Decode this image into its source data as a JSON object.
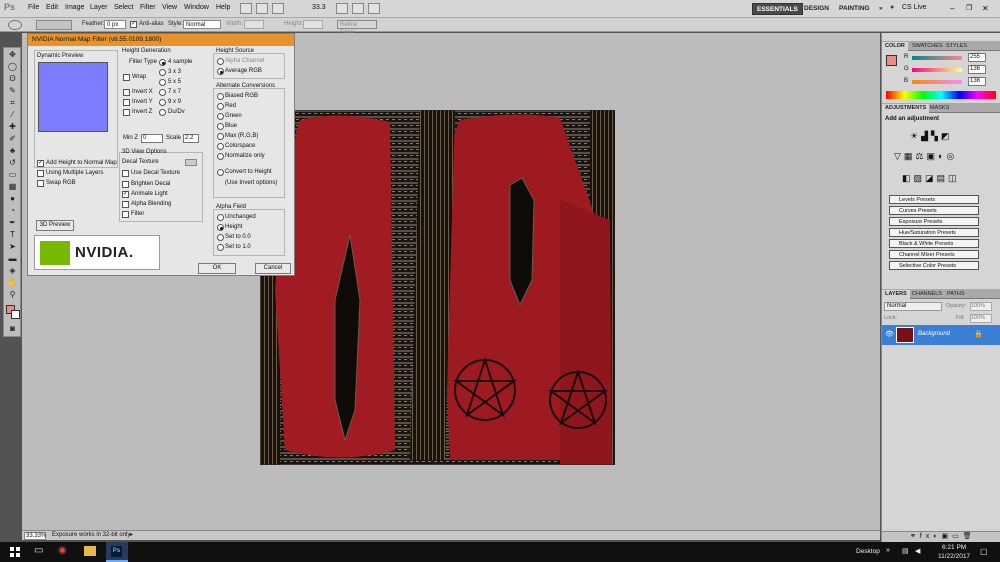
{
  "menu": {
    "logo": "Ps",
    "items": [
      "File",
      "Edit",
      "Image",
      "Layer",
      "Select",
      "Filter",
      "View",
      "Window",
      "Help"
    ],
    "zoom": "33.3",
    "workspaces": [
      "ESSENTIALS",
      "DESIGN",
      "PAINTING"
    ],
    "cs_live": "CS Live"
  },
  "options": {
    "feather_label": "Feather:",
    "feather_value": "0 px",
    "antialias_label": "Anti-alias",
    "style_label": "Style:",
    "style_value": "Normal",
    "width_label": "Width:",
    "height_label": "Height:",
    "refine_edge": "Refine Edge..."
  },
  "dialog": {
    "title": "NVIDIA Normal Map Filter (v8.55.0109.1800)",
    "dynamic_preview": "Dynamic Preview",
    "height_generation": "Height Generation",
    "filter_type": "Filter Type",
    "samples": [
      "4 sample",
      "3 x 3",
      "5 x 5",
      "7 x 7",
      "9 x 9",
      "Du/Dv"
    ],
    "wrap": "Wrap",
    "invert_x": "Invert X",
    "invert_y": "Invert Y",
    "invert_z": "Invert Z",
    "min_z_label": "Min Z",
    "min_z_value": "0",
    "scale_label": "Scale",
    "scale_value": "2.2",
    "add_height": "Add Height to Normal Map",
    "multiple_layers": "Using Multiple Layers",
    "swap_rgb": "Swap RGB",
    "view_options": "3D View Options",
    "decal_texture": "Decal Texture",
    "use_decal": "Use Decal Texture",
    "brighten_decal": "Brighten Decal",
    "animate_light": "Animate Light",
    "alpha_blending": "Alpha Blending",
    "filter": "Filter",
    "preview_3d": "3D Preview",
    "nvidia_logo": "NVIDIA.",
    "height_source": "Height Source",
    "alpha_channel": "Alpha Channel",
    "average_rgb": "Average RGB",
    "alternate_conversions": "Alternate Conversions",
    "conversions": [
      "Biased RGB",
      "Red",
      "Green",
      "Blue",
      "Max (R,G,B)",
      "Colorspace",
      "Normalize only"
    ],
    "convert_to_height": "Convert to Height",
    "use_invert": "(Use Invert options)",
    "alpha_field": "Alpha Field",
    "alpha_options": [
      "Unchanged",
      "Height",
      "Set to 0.0",
      "Set to 1.0"
    ],
    "ok": "OK",
    "cancel": "Cancel"
  },
  "status": {
    "zoom": "33.33%",
    "message": "Exposure works in 32-bit only"
  },
  "color_panel": {
    "tabs": [
      "COLOR",
      "SWATCHES",
      "STYLES"
    ],
    "r_label": "R",
    "g_label": "G",
    "b_label": "B",
    "r": "255",
    "g": "136",
    "b": "136",
    "fg_color": "#f08888"
  },
  "adjustments": {
    "tabs": [
      "ADJUSTMENTS",
      "MASKS"
    ],
    "heading": "Add an adjustment",
    "presets": [
      "Levels Presets",
      "Curves Presets",
      "Exposure Presets",
      "Hue/Saturation Presets",
      "Black & White Presets",
      "Channel Mixer Presets",
      "Selective Color Presets"
    ]
  },
  "layers": {
    "tabs": [
      "LAYERS",
      "CHANNELS",
      "PATHS"
    ],
    "blend_mode": "Normal",
    "opacity_label": "Opacity:",
    "opacity": "100%",
    "fill_label": "Fill:",
    "fill": "100%",
    "lock_label": "Lock:",
    "layer_name": "Background"
  },
  "taskbar": {
    "desktop": "Desktop",
    "time": "6:21 PM",
    "date": "11/22/2017"
  },
  "colors": {
    "accent_title": "#e8922a",
    "preview_blue": "#7c7cff",
    "layer_selected": "#3a7fd5"
  }
}
